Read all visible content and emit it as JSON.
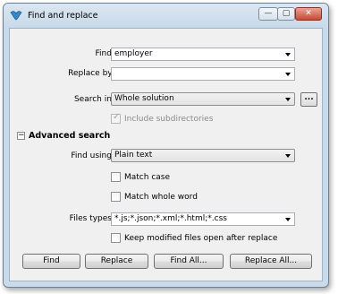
{
  "window": {
    "title": "Find and replace"
  },
  "title_controls": {
    "minimize": "—",
    "maximize": "▢",
    "close": "✕"
  },
  "find": {
    "label": "Find:",
    "value": "employer"
  },
  "replace_by": {
    "label": "Replace by:",
    "value": ""
  },
  "search_in": {
    "label": "Search in:",
    "value": "Whole solution",
    "browse": "..."
  },
  "include_subdirs": {
    "label": "Include subdirectories",
    "checked": true,
    "enabled": false
  },
  "advanced": {
    "title": "Advanced search",
    "toggle": "−",
    "find_using": {
      "label": "Find using:",
      "value": "Plain text"
    },
    "match_case": {
      "label": "Match case",
      "checked": false
    },
    "match_whole_word": {
      "label": "Match whole word",
      "checked": false
    },
    "file_types": {
      "label": "Files types:",
      "value": "*.js;*.json;*.xml;*.html;*.css"
    },
    "keep_open": {
      "label": "Keep modified files open after replace",
      "checked": false
    }
  },
  "buttons": {
    "find": "Find",
    "replace": "Replace",
    "find_all": "Find All...",
    "replace_all": "Replace All..."
  }
}
